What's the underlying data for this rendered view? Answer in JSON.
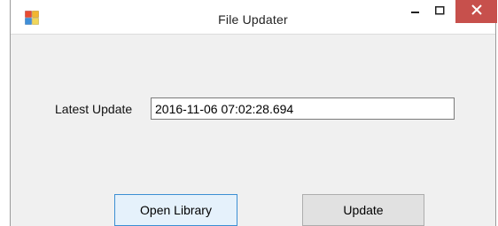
{
  "window": {
    "title": "File Updater"
  },
  "titlebar": {
    "app_icon": "application-icon",
    "minimize_icon": "minimize-icon",
    "maximize_icon": "maximize-icon",
    "close_icon": "close-icon",
    "close_color": "#c7504c"
  },
  "form": {
    "latest_update_label": "Latest Update",
    "latest_update_value": "2016-11-06 07:02:28.694"
  },
  "buttons": {
    "open_library_label": "Open Library",
    "update_label": "Update"
  }
}
